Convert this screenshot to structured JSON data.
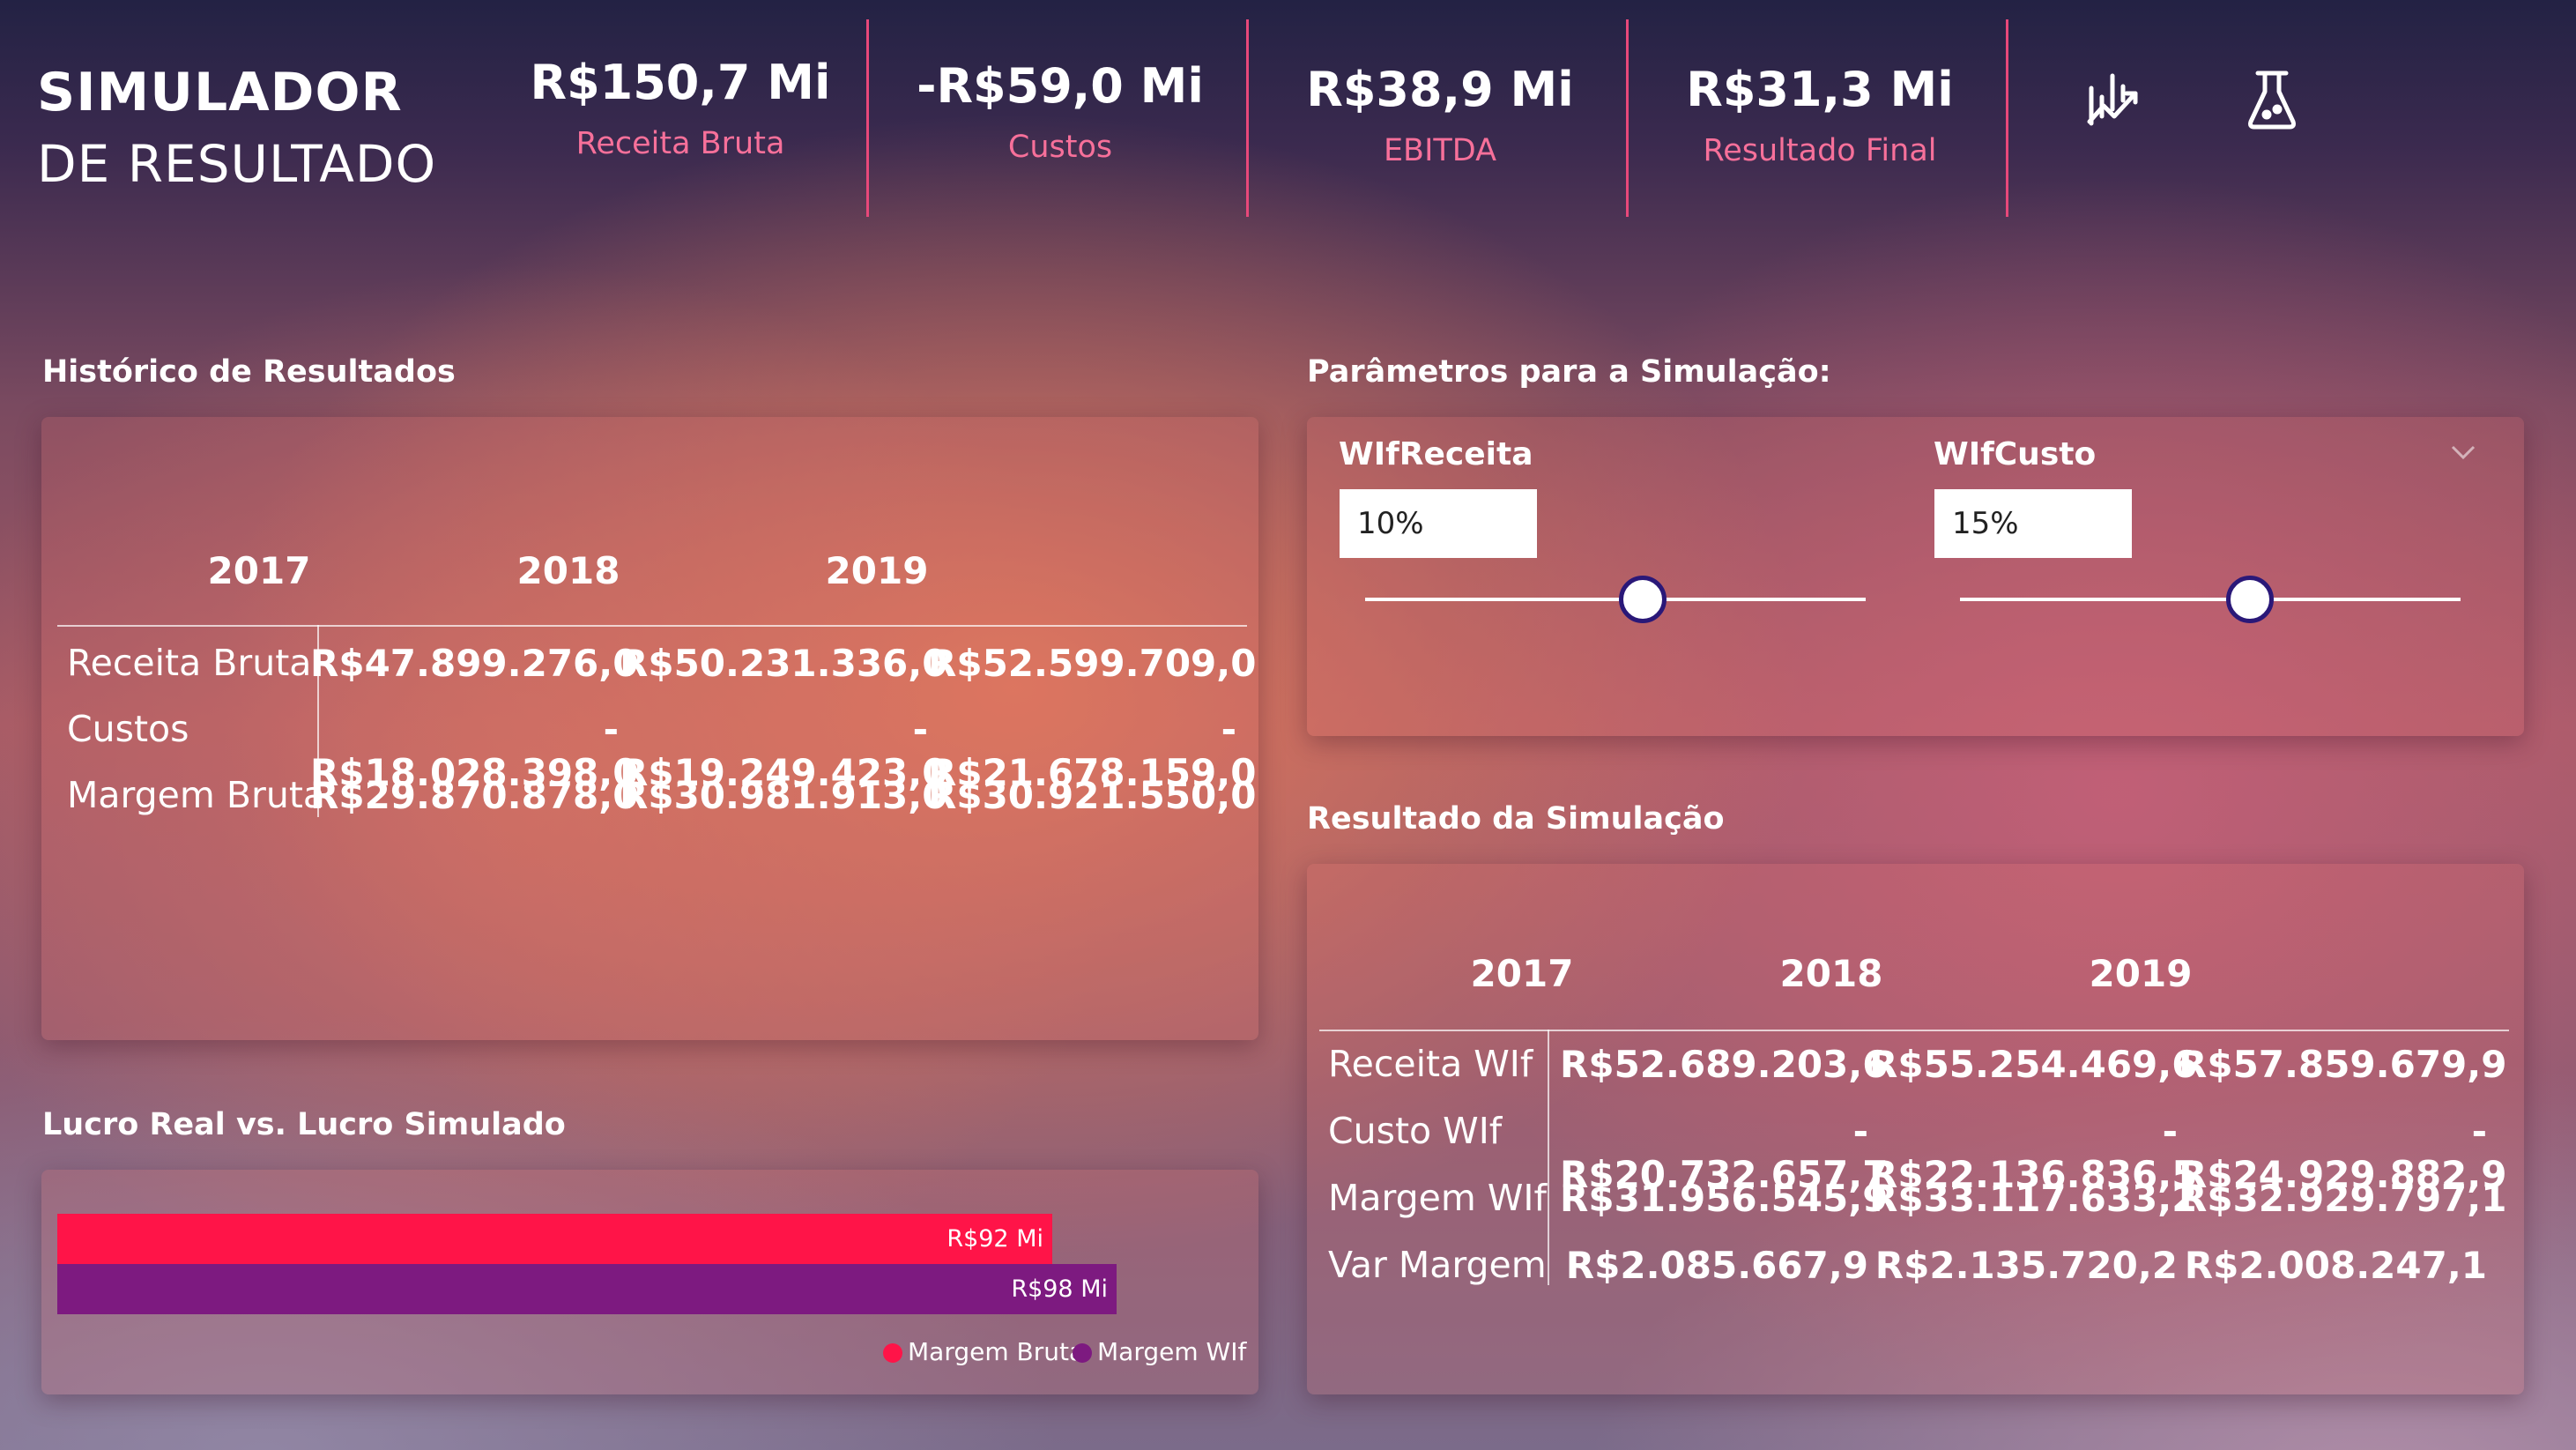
{
  "header": {
    "title_line1": "SIMULADOR",
    "title_line2": "DE RESULTADO",
    "kpis": [
      {
        "value": "R$150,7 Mi",
        "label": "Receita Bruta"
      },
      {
        "value": "-R$59,0 Mi",
        "label": "Custos"
      },
      {
        "value": "R$38,9 Mi",
        "label": "EBITDA"
      },
      {
        "value": "R$31,3 Mi",
        "label": "Resultado Final"
      }
    ],
    "icons": [
      "chart-analytics-icon",
      "flask-icon"
    ],
    "accent_color": "#f7709a"
  },
  "historico": {
    "title": "Histórico de Resultados",
    "columns": [
      "2017",
      "2018",
      "2019"
    ],
    "rows": [
      {
        "label": "Receita Bruta",
        "values": [
          "R$47.899.276,0",
          "R$50.231.336,0",
          "R$52.599.709,0"
        ]
      },
      {
        "label": "Custos",
        "values": [
          "-R$18.028.398,0",
          "-R$19.249.423,0",
          "-R$21.678.159,0"
        ]
      },
      {
        "label": "Margem Bruta",
        "values": [
          "R$29.870.878,0",
          "R$30.981.913,0",
          "R$30.921.550,0"
        ]
      }
    ]
  },
  "parametros": {
    "title": "Parâmetros para a Simulação:",
    "sliders": [
      {
        "label": "WIfReceita",
        "value": "10%",
        "position": 0.55
      },
      {
        "label": "WIfCusto",
        "value": "15%",
        "position": 0.58
      }
    ]
  },
  "resultado": {
    "title": "Resultado da Simulação",
    "columns": [
      "2017",
      "2018",
      "2019"
    ],
    "rows": [
      {
        "label": "Receita WIf",
        "values": [
          "R$52.689.203,6",
          "R$55.254.469,6",
          "R$57.859.679,9"
        ]
      },
      {
        "label": "Custo WIf",
        "values": [
          "-R$20.732.657,7",
          "-R$22.136.836,5",
          "-R$24.929.882,9"
        ]
      },
      {
        "label": "Margem WIf",
        "values": [
          "R$31.956.545,9",
          "R$33.117.633,2",
          "R$32.929.797,1"
        ]
      },
      {
        "label": "Var Margem",
        "values": [
          "R$2.085.667,9",
          "R$2.135.720,2",
          "R$2.008.247,1"
        ]
      }
    ]
  },
  "lucro": {
    "title": "Lucro Real vs. Lucro Simulado",
    "chart_data": {
      "type": "bar",
      "orientation": "horizontal",
      "series": [
        {
          "name": "Margem Bruta",
          "value": 92,
          "label": "R$92 Mi",
          "color": "#ff1448"
        },
        {
          "name": "Margem WIf",
          "value": 98,
          "label": "R$98 Mi",
          "color": "#7d1a80"
        }
      ],
      "legend": "bottom-right",
      "xlim": [
        0,
        104
      ]
    }
  }
}
